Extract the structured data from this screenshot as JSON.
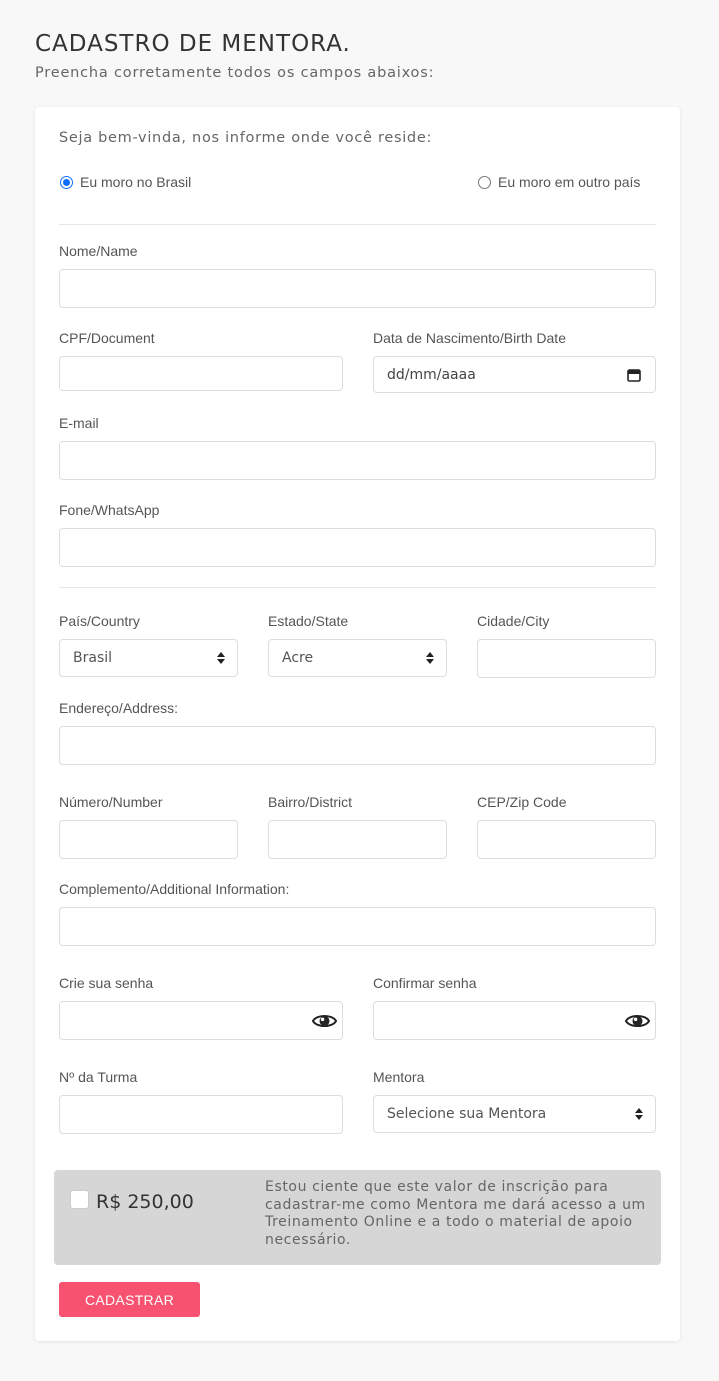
{
  "header": {
    "title": "CADASTRO DE MENTORA.",
    "subtitle": "Preencha corretamente todos os campos abaixos:"
  },
  "residence": {
    "prompt": "Seja bem-vinda, nos informe onde você reside:",
    "options": [
      {
        "label": "Eu moro no Brasil",
        "checked": true
      },
      {
        "label": "Eu moro em outro país",
        "checked": false
      }
    ]
  },
  "fields": {
    "name": {
      "label": "Nome/Name",
      "value": ""
    },
    "cpf": {
      "label": "CPF/Document",
      "value": ""
    },
    "birth": {
      "label": "Data de Nascimento/Birth Date",
      "placeholder": "dd/mm/aaaa"
    },
    "email": {
      "label": "E-mail",
      "value": ""
    },
    "phone": {
      "label": "Fone/WhatsApp",
      "value": ""
    },
    "country": {
      "label": "País/Country",
      "selected": "Brasil"
    },
    "state": {
      "label": "Estado/State",
      "selected": "Acre"
    },
    "city": {
      "label": "Cidade/City",
      "value": ""
    },
    "address": {
      "label": "Endereço/Address:",
      "value": ""
    },
    "number": {
      "label": "Número/Number",
      "value": ""
    },
    "district": {
      "label": "Bairro/District",
      "value": ""
    },
    "zip": {
      "label": "CEP/Zip Code",
      "value": ""
    },
    "complement": {
      "label": "Complemento/Additional Information:",
      "value": ""
    },
    "password": {
      "label": "Crie sua senha",
      "icon": "eye-icon"
    },
    "confirm_password": {
      "label": "Confirmar senha",
      "icon": "eye-icon"
    },
    "class_number": {
      "label": "Nº da Turma",
      "value": ""
    },
    "mentor": {
      "label": "Mentora",
      "selected": "Selecione sua Mentora"
    }
  },
  "payment": {
    "price": "R$ 250,00",
    "checked": false,
    "terms": "Estou ciente que este valor de inscrição para cadastrar-me como Mentora me dará acesso a um Treinamento Online e a todo o material de apoio necessário."
  },
  "submit_label": "CADASTRAR",
  "colors": {
    "accent": "#f75371",
    "radio_checked": "#0d6efd",
    "price_box": "#d6d6d6",
    "background": "#f8f8f8"
  }
}
